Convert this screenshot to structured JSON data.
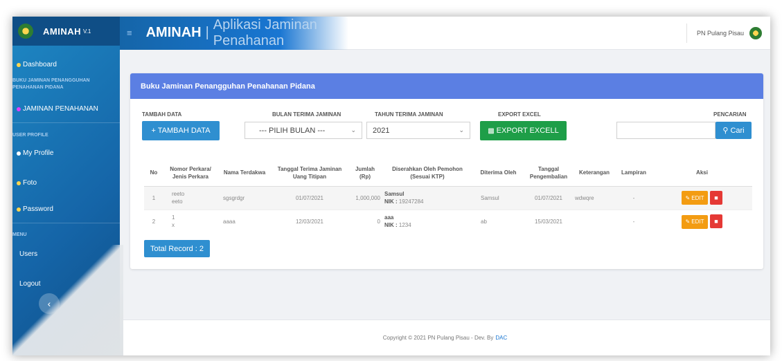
{
  "brand": {
    "name": "AMINAH",
    "version": "V.1"
  },
  "header": {
    "app_name": "AMINAH",
    "separator": "|",
    "app_desc": "Aplikasi Jaminan Penahanan",
    "user": "PN Pulang Pisau"
  },
  "sidebar": {
    "items": [
      {
        "label": "Dashboard",
        "dot_color": "#ffd54f"
      },
      {
        "label": "BUKU JAMINAN PENANGGUHAN PENAHANAN PIDANA",
        "type": "header"
      },
      {
        "label": "JAMINAN PENAHANAN",
        "dot_color": "#e040fb"
      },
      {
        "label": "USER PROFILE",
        "type": "header"
      },
      {
        "label": "My Profile",
        "dot_color": "#ffffff"
      },
      {
        "label": "Foto",
        "dot_color": "#ffd54f"
      },
      {
        "label": "Password",
        "dot_color": "#ffd54f"
      },
      {
        "label": "MENU",
        "type": "header"
      },
      {
        "label": "Users"
      },
      {
        "label": "Logout"
      }
    ],
    "collapse_icon": "‹"
  },
  "card": {
    "title": "Buku Jaminan Penangguhan Penahanan Pidana",
    "filters": {
      "tambah_label": "TAMBAH DATA",
      "tambah_button": "+ TAMBAH DATA",
      "bulan_label": "BULAN TERIMA JAMINAN",
      "bulan_value": "--- PILIH BULAN ---",
      "tahun_label": "TAHUN TERIMA JAMINAN",
      "tahun_value": "2021",
      "export_label": "EXPORT EXCEL",
      "export_button": "EXPORT EXCELL",
      "search_label": "PENCARIAN",
      "search_placeholder": "",
      "search_button": "Cari"
    },
    "table": {
      "headers": [
        "No",
        "Nomor Perkara/ Jenis Perkara",
        "Nama Terdakwa",
        "Tanggal Terima Jaminan Uang Titipan",
        "Jumlah (Rp)",
        "Diserahkan Oleh Pemohon (Sesuai KTP)",
        "Diterima Oleh",
        "Tanggal Pengembalian",
        "Keterangan",
        "Lampiran",
        "Aksi"
      ],
      "rows": [
        {
          "no": "1",
          "nomor": "reeto",
          "jenis": "eeto",
          "terdakwa": "sgsgrdgr",
          "tanggal_terima": "01/07/2021",
          "jumlah": "1,000,000",
          "pemohon": "Samsul",
          "nik_label": "NIK :",
          "nik": "19247284",
          "diterima": "Samsul",
          "tanggal_kembali": "01/07/2021",
          "keterangan": "wdwqre",
          "lampiran": "-",
          "edit": "EDIT"
        },
        {
          "no": "2",
          "nomor": "1",
          "jenis": "x",
          "terdakwa": "aaaa",
          "tanggal_terima": "12/03/2021",
          "jumlah": "0",
          "pemohon": "aaa",
          "nik_label": "NIK :",
          "nik": "1234",
          "diterima": "ab",
          "tanggal_kembali": "15/03/2021",
          "keterangan": "",
          "lampiran": "-",
          "edit": "EDIT"
        }
      ]
    },
    "total": "Total Record : 2"
  },
  "footer": {
    "text": "Copyright © 2021 PN Pulang Pisau - Dev. By",
    "link": "DAC"
  },
  "colors": {
    "card_header": "#5b7fe3",
    "primary": "#2f8fd0",
    "success": "#1e9e48",
    "warning": "#f39c12",
    "danger": "#e53935"
  }
}
